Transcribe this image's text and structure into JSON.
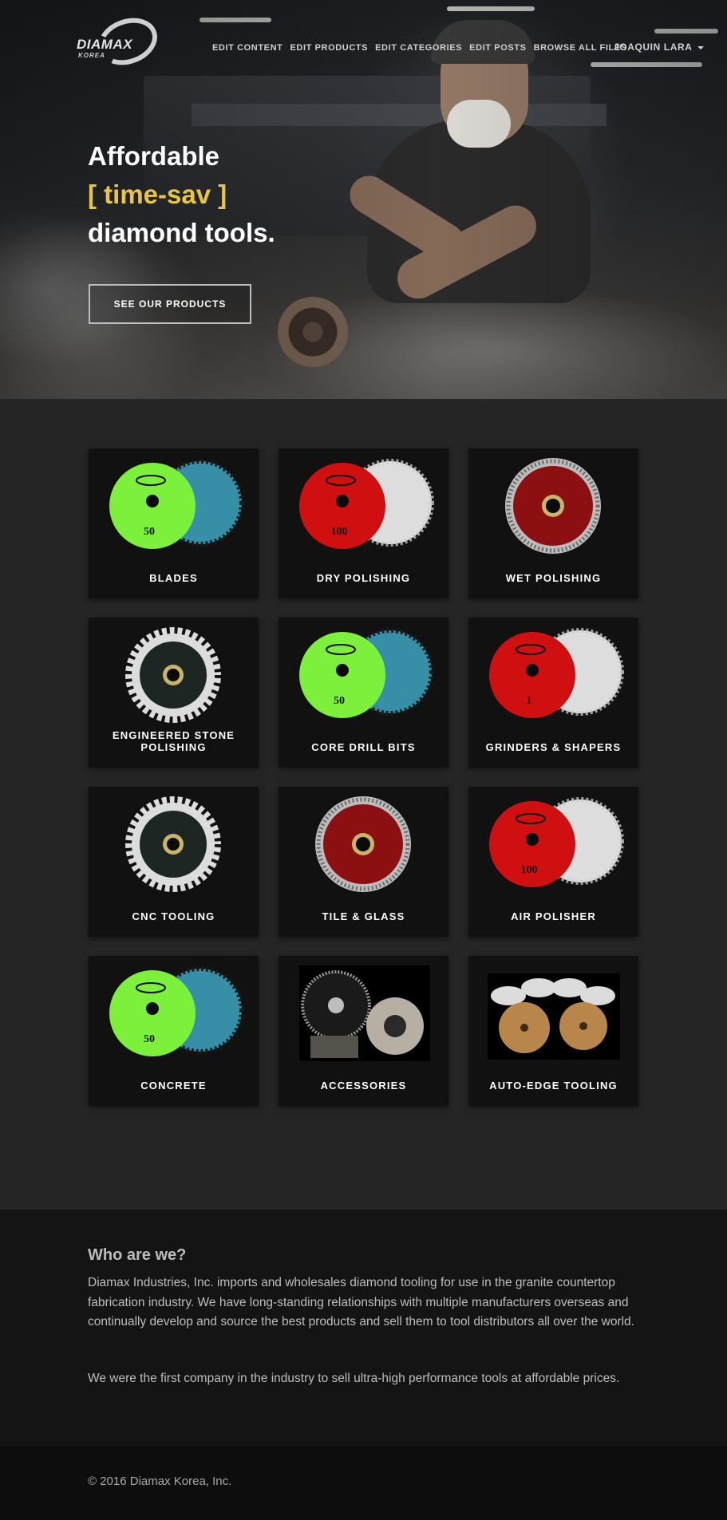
{
  "brand": {
    "name": "DIAMAX",
    "sub": "KOREA"
  },
  "nav": {
    "items": [
      "EDIT CONTENT",
      "EDIT PRODUCTS",
      "EDIT CATEGORIES",
      "EDIT POSTS",
      "BROWSE ALL FILES"
    ],
    "user": "JOAQUIN LARA"
  },
  "hero": {
    "line1": "Affordable",
    "line2": "[ time-sav ]",
    "line3": "diamond tools.",
    "cta": "SEE OUR PRODUCTS",
    "accent_color": "#e8c547"
  },
  "categories": [
    {
      "label": "BLADES",
      "icon": "green-polishing-pad"
    },
    {
      "label": "DRY POLISHING",
      "icon": "red-polishing-pad"
    },
    {
      "label": "WET POLISHING",
      "icon": "red-saw-blade"
    },
    {
      "label": "ENGINEERED STONE POLISHING",
      "icon": "turbo-blade"
    },
    {
      "label": "CORE DRILL BITS",
      "icon": "green-polishing-pad"
    },
    {
      "label": "GRINDERS & SHAPERS",
      "icon": "red-polishing-pad"
    },
    {
      "label": "CNC TOOLING",
      "icon": "turbo-blade"
    },
    {
      "label": "TILE & GLASS",
      "icon": "red-saw-blade"
    },
    {
      "label": "AIR POLISHER",
      "icon": "red-polishing-pad"
    },
    {
      "label": "CONCRETE",
      "icon": "green-polishing-pad"
    },
    {
      "label": "ACCESSORIES",
      "icon": "blade-and-flange"
    },
    {
      "label": "AUTO-EDGE TOOLING",
      "icon": "edge-wheels"
    }
  ],
  "pad_numbers": [
    "50",
    "100",
    "",
    "",
    "50",
    "1",
    "",
    "",
    "100",
    "50",
    "",
    ""
  ],
  "about": {
    "title": "Who are we?",
    "p1": "Diamax Industries, Inc. imports and wholesales diamond tooling for use in the granite countertop fabrication industry. We have long-standing relationships with multiple manufacturers overseas and continually develop and source the best products and sell them to tool distributors all over the world.",
    "p2": "We were the first company in the industry to sell ultra-high performance tools at affordable prices."
  },
  "footer": {
    "copyright": "© 2016 Diamax Korea, Inc."
  }
}
